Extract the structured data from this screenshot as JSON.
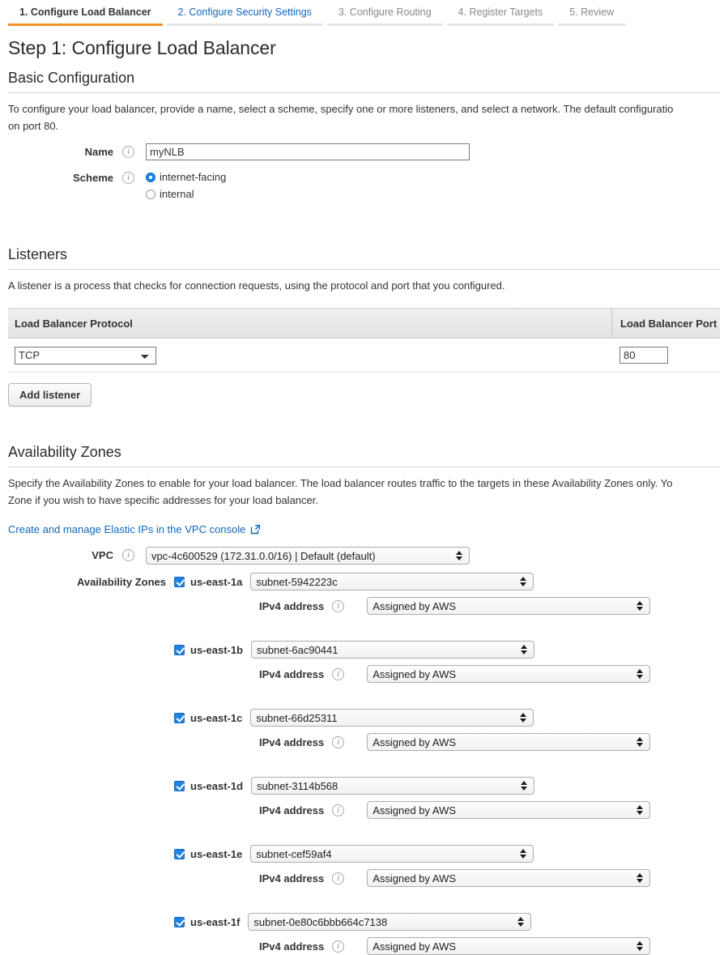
{
  "wizard": {
    "tabs": [
      {
        "label": "1. Configure Load Balancer",
        "state": "active"
      },
      {
        "label": "2. Configure Security Settings",
        "state": "link"
      },
      {
        "label": "3. Configure Routing",
        "state": "done"
      },
      {
        "label": "4. Register Targets",
        "state": "done"
      },
      {
        "label": "5. Review",
        "state": "done"
      }
    ],
    "active_underline_color": "#ef9128",
    "link_color": "#1166bb"
  },
  "page": {
    "title": "Step 1: Configure Load Balancer"
  },
  "basic_configuration": {
    "heading": "Basic Configuration",
    "description": "To configure your load balancer, provide a name, select a scheme, specify one or more listeners, and select a network. The default configuratio\non port 80.",
    "name": {
      "label": "Name",
      "value": "myNLB",
      "info_icon": "info-icon"
    },
    "scheme": {
      "label": "Scheme",
      "info_icon": "info-icon",
      "options": [
        {
          "label": "internet-facing",
          "selected": true
        },
        {
          "label": "internal",
          "selected": false
        }
      ]
    }
  },
  "listeners": {
    "heading": "Listeners",
    "description": "A listener is a process that checks for connection requests, using the protocol and port that you configured.",
    "columns": [
      "Load Balancer Protocol",
      "Load Balancer Port"
    ],
    "rows": [
      {
        "protocol": "TCP",
        "port": "80"
      }
    ],
    "add_listener_label": "Add listener"
  },
  "availability_zones": {
    "heading": "Availability Zones",
    "description": "Specify the Availability Zones to enable for your load balancer. The load balancer routes traffic to the targets in these Availability Zones only. Yo\nZone if you wish to have specific addresses for your load balancer.",
    "elastic_ip_link": "Create and manage Elastic IPs in the VPC console",
    "elastic_ip_link_icon": "external-link-icon",
    "vpc": {
      "label": "VPC",
      "value": "vpc-4c600529 (172.31.0.0/16) | Default (default)",
      "info_icon": "info-icon"
    },
    "zones_label": "Availability Zones",
    "ipv4_label": "IPv4 address",
    "zones": [
      {
        "name": "us-east-1a",
        "checked": true,
        "subnet": "subnet-5942223c",
        "ipv4": "Assigned by AWS"
      },
      {
        "name": "us-east-1b",
        "checked": true,
        "subnet": "subnet-6ac90441",
        "ipv4": "Assigned by AWS"
      },
      {
        "name": "us-east-1c",
        "checked": true,
        "subnet": "subnet-66d25311",
        "ipv4": "Assigned by AWS"
      },
      {
        "name": "us-east-1d",
        "checked": true,
        "subnet": "subnet-3114b568",
        "ipv4": "Assigned by AWS"
      },
      {
        "name": "us-east-1e",
        "checked": true,
        "subnet": "subnet-cef59af4",
        "ipv4": "Assigned by AWS"
      },
      {
        "name": "us-east-1f",
        "checked": true,
        "subnet": "subnet-0e80c6bbb664c7138",
        "ipv4": "Assigned by AWS"
      }
    ]
  }
}
